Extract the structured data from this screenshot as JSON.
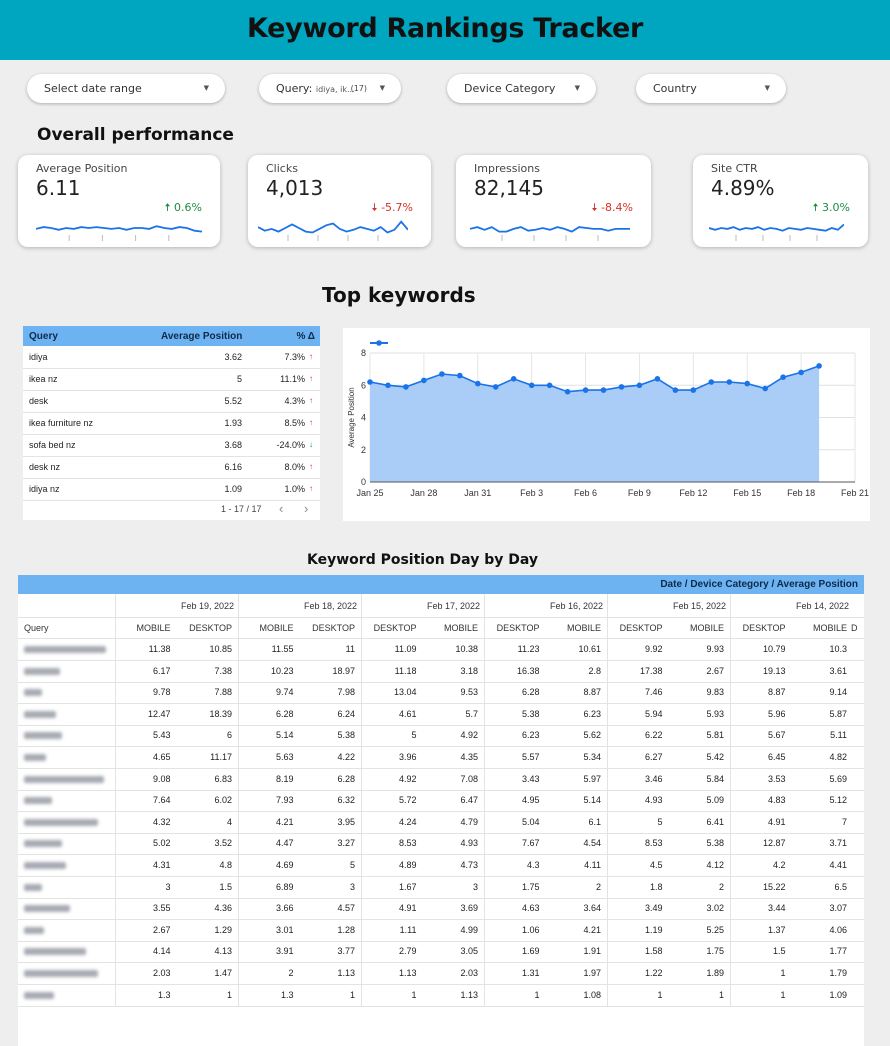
{
  "header": {
    "title": "Keyword Rankings Tracker"
  },
  "filters": {
    "date_range": "Select date range",
    "query_label": "Query:",
    "query_value": "idiya, ik...",
    "query_count": "(17)",
    "device_category": "Device Category",
    "country": "Country"
  },
  "overall": {
    "title": "Overall performance",
    "kpis": [
      {
        "label": "Average Position",
        "value": "6.11",
        "delta": "0.6%",
        "direction": "up"
      },
      {
        "label": "Clicks",
        "value": "4,013",
        "delta": "-5.7%",
        "direction": "down"
      },
      {
        "label": "Impressions",
        "value": "82,145",
        "delta": "-8.4%",
        "direction": "down"
      },
      {
        "label": "Site CTR",
        "value": "4.89%",
        "delta": "3.0%",
        "direction": "up"
      }
    ]
  },
  "top_keywords": {
    "title": "Top keywords",
    "columns": [
      "Query",
      "Average Position",
      "% Δ"
    ],
    "rows": [
      {
        "query": "idiya",
        "position": "3.62",
        "delta": "7.3%",
        "direction": "up"
      },
      {
        "query": "ikea nz",
        "position": "5",
        "delta": "11.1%",
        "direction": "up"
      },
      {
        "query": "desk",
        "position": "5.52",
        "delta": "4.3%",
        "direction": "up"
      },
      {
        "query": "ikea furniture nz",
        "position": "1.93",
        "delta": "8.5%",
        "direction": "up"
      },
      {
        "query": "sofa bed nz",
        "position": "3.68",
        "delta": "-24.0%",
        "direction": "down"
      },
      {
        "query": "desk nz",
        "position": "6.16",
        "delta": "8.0%",
        "direction": "up"
      },
      {
        "query": "idiya nz",
        "position": "1.09",
        "delta": "1.0%",
        "direction": "up"
      }
    ],
    "pager": "1 - 17 / 17",
    "prev_icon": "chevron-left-icon",
    "next_icon": "chevron-right-icon"
  },
  "chart_data": {
    "type": "area",
    "title": "",
    "xlabel": "",
    "ylabel": "Average Position",
    "ylim": [
      0,
      8
    ],
    "yticks": [
      "0",
      "2",
      "4",
      "6",
      "8"
    ],
    "xticks": [
      "Jan 25",
      "Jan 28",
      "Jan 31",
      "Feb 3",
      "Feb 6",
      "Feb 9",
      "Feb 12",
      "Feb 15",
      "Feb 18",
      "Feb 21"
    ],
    "x": [
      "Jan 25",
      "Jan 26",
      "Jan 27",
      "Jan 28",
      "Jan 29",
      "Jan 30",
      "Jan 31",
      "Feb 1",
      "Feb 2",
      "Feb 3",
      "Feb 4",
      "Feb 5",
      "Feb 6",
      "Feb 7",
      "Feb 8",
      "Feb 9",
      "Feb 10",
      "Feb 11",
      "Feb 12",
      "Feb 13",
      "Feb 14",
      "Feb 15",
      "Feb 16",
      "Feb 17",
      "Feb 18",
      "Feb 19"
    ],
    "series": [
      {
        "values": [
          6.2,
          6.0,
          5.9,
          6.3,
          6.7,
          6.6,
          6.1,
          5.9,
          6.4,
          6.0,
          6.0,
          5.6,
          5.7,
          5.7,
          5.9,
          6.0,
          6.4,
          5.7,
          5.7,
          6.2,
          6.2,
          6.1,
          5.8,
          6.5,
          6.8,
          7.2
        ]
      }
    ],
    "grid": true,
    "legend": "top-left",
    "color": "#1a73e8",
    "fill": "#a9cdf7"
  },
  "day_by_day": {
    "title": "Keyword Position Day by Day",
    "header": "Date / Device Category / Average Position",
    "query_header": "Query",
    "dates": [
      "Feb 19, 2022",
      "Feb 18, 2022",
      "Feb 17, 2022",
      "Feb 16, 2022",
      "Feb 15, 2022",
      "Feb 14, 2022"
    ],
    "device_headers": [
      "MOBILE",
      "DESKTOP",
      "MOBILE",
      "DESKTOP",
      "DESKTOP",
      "MOBILE",
      "DESKTOP",
      "MOBILE",
      "DESKTOP",
      "MOBILE",
      "DESKTOP",
      "MOBILE",
      "D"
    ],
    "rows": [
      [
        "11.38",
        "10.85",
        "11.55",
        "11",
        "11.09",
        "10.38",
        "11.23",
        "10.61",
        "9.92",
        "9.93",
        "10.79",
        "10.3"
      ],
      [
        "6.17",
        "7.38",
        "10.23",
        "18.97",
        "11.18",
        "3.18",
        "16.38",
        "2.8",
        "17.38",
        "2.67",
        "19.13",
        "3.61"
      ],
      [
        "9.78",
        "7.88",
        "9.74",
        "7.98",
        "13.04",
        "9.53",
        "6.28",
        "8.87",
        "7.46",
        "9.83",
        "8.87",
        "9.14"
      ],
      [
        "12.47",
        "18.39",
        "6.28",
        "6.24",
        "4.61",
        "5.7",
        "5.38",
        "6.23",
        "5.94",
        "5.93",
        "5.96",
        "5.87"
      ],
      [
        "5.43",
        "6",
        "5.14",
        "5.38",
        "5",
        "4.92",
        "6.23",
        "5.62",
        "6.22",
        "5.81",
        "5.67",
        "5.11"
      ],
      [
        "4.65",
        "11.17",
        "5.63",
        "4.22",
        "3.96",
        "4.35",
        "5.57",
        "5.34",
        "6.27",
        "5.42",
        "6.45",
        "4.82"
      ],
      [
        "9.08",
        "6.83",
        "8.19",
        "6.28",
        "4.92",
        "7.08",
        "3.43",
        "5.97",
        "3.46",
        "5.84",
        "3.53",
        "5.69"
      ],
      [
        "7.64",
        "6.02",
        "7.93",
        "6.32",
        "5.72",
        "6.47",
        "4.95",
        "5.14",
        "4.93",
        "5.09",
        "4.83",
        "5.12"
      ],
      [
        "4.32",
        "4",
        "4.21",
        "3.95",
        "4.24",
        "4.79",
        "5.04",
        "6.1",
        "5",
        "6.41",
        "4.91",
        "7"
      ],
      [
        "5.02",
        "3.52",
        "4.47",
        "3.27",
        "8.53",
        "4.93",
        "7.67",
        "4.54",
        "8.53",
        "5.38",
        "12.87",
        "3.71"
      ],
      [
        "4.31",
        "4.8",
        "4.69",
        "5",
        "4.89",
        "4.73",
        "4.3",
        "4.11",
        "4.5",
        "4.12",
        "4.2",
        "4.41"
      ],
      [
        "3",
        "1.5",
        "6.89",
        "3",
        "1.67",
        "3",
        "1.75",
        "2",
        "1.8",
        "2",
        "15.22",
        "6.5"
      ],
      [
        "3.55",
        "4.36",
        "3.66",
        "4.57",
        "4.91",
        "3.69",
        "4.63",
        "3.64",
        "3.49",
        "3.02",
        "3.44",
        "3.07"
      ],
      [
        "2.67",
        "1.29",
        "3.01",
        "1.28",
        "1.11",
        "4.99",
        "1.06",
        "4.21",
        "1.19",
        "5.25",
        "1.37",
        "4.06"
      ],
      [
        "4.14",
        "4.13",
        "3.91",
        "3.77",
        "2.79",
        "3.05",
        "1.69",
        "1.91",
        "1.58",
        "1.75",
        "1.5",
        "1.77"
      ],
      [
        "2.03",
        "1.47",
        "2",
        "1.13",
        "1.13",
        "2.03",
        "1.31",
        "1.97",
        "1.22",
        "1.89",
        "1",
        "1.79"
      ],
      [
        "1.3",
        "1",
        "1.3",
        "1",
        "1",
        "1.13",
        "1",
        "1.08",
        "1",
        "1",
        "1",
        "1.09"
      ]
    ]
  },
  "colors": {
    "header": "#00a6bf",
    "table_header": "#6db3f2",
    "up": "#1e8e3e",
    "down": "#d93025",
    "line": "#1a73e8"
  },
  "kpi_sparks": [
    [
      0.45,
      0.55,
      0.5,
      0.4,
      0.5,
      0.45,
      0.55,
      0.5,
      0.55,
      0.5,
      0.45,
      0.5,
      0.4,
      0.5,
      0.5,
      0.45,
      0.6,
      0.5,
      0.45,
      0.55,
      0.5,
      0.35,
      0.3
    ],
    [
      0.55,
      0.35,
      0.45,
      0.3,
      0.5,
      0.7,
      0.5,
      0.3,
      0.25,
      0.45,
      0.65,
      0.75,
      0.45,
      0.3,
      0.4,
      0.55,
      0.45,
      0.35,
      0.55,
      0.25,
      0.4,
      0.85,
      0.4
    ],
    [
      0.45,
      0.55,
      0.4,
      0.55,
      0.3,
      0.3,
      0.45,
      0.55,
      0.35,
      0.4,
      0.5,
      0.4,
      0.55,
      0.45,
      0.3,
      0.55,
      0.5,
      0.45,
      0.45,
      0.35,
      0.45,
      0.45,
      0.45
    ],
    [
      0.5,
      0.4,
      0.5,
      0.45,
      0.55,
      0.4,
      0.5,
      0.45,
      0.55,
      0.4,
      0.5,
      0.45,
      0.35,
      0.5,
      0.45,
      0.4,
      0.5,
      0.45,
      0.4,
      0.35,
      0.5,
      0.4,
      0.7
    ]
  ]
}
